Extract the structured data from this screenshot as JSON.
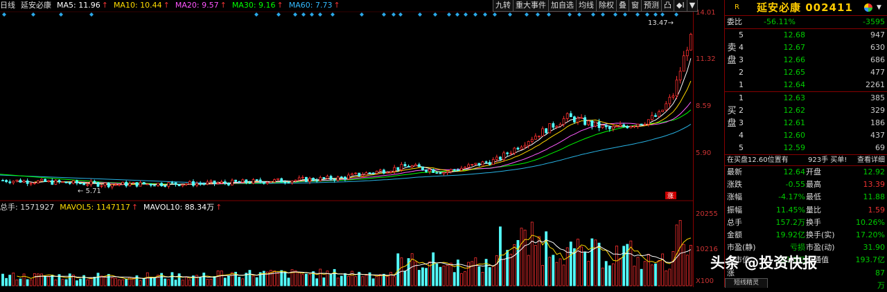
{
  "ma": {
    "period": "日线",
    "name": "延安必康",
    "ma5": "MA5: 11.96",
    "ma10": "MA10: 10.44",
    "ma20": "MA20: 9.57",
    "ma30": "MA30: 9.16",
    "ma60": "MA60: 7.73",
    "arrow": "↑"
  },
  "toolbar": [
    "九转",
    "重大事件",
    "加自选",
    "均线",
    "除权",
    "叠",
    "窗",
    "预测",
    "凸",
    "◆I",
    "▼"
  ],
  "chart_data": {
    "type": "candlestick",
    "price_ticks": [
      "14.01",
      "11.32",
      "8.59",
      "5.90"
    ],
    "price_range": [
      5.2,
      14.5
    ],
    "max_label": "13.47",
    "min_label": "5.71",
    "badge": "涨",
    "volume_ticks": [
      "20255",
      "10216",
      "X100"
    ],
    "volume_max": 21500,
    "colors": {
      "up": "#ff3030",
      "down": "#54ffff",
      "ma5": "#ffffff",
      "ma10": "#ffd700",
      "ma20": "#ff5cff",
      "ma30": "#00ff00",
      "ma60": "#28b4e6",
      "grid": "#800000"
    }
  },
  "volume": {
    "total": "总手: 1571927",
    "mavol5": "MAVOL5: 1147117",
    "mavol10": "MAVOL10: 88.34万",
    "arrow": "↑"
  },
  "quote": {
    "r": "R",
    "title": "延安必康 002411",
    "weibi_label": "委比",
    "weibi_pct": "-56.11%",
    "weibi_val": "-3595",
    "sell_side": "卖盘",
    "buy_side": "买盘",
    "asks": [
      {
        "n": "5",
        "p": "12.68",
        "v": "947"
      },
      {
        "n": "4",
        "p": "12.67",
        "v": "630"
      },
      {
        "n": "3",
        "p": "12.66",
        "v": "686"
      },
      {
        "n": "2",
        "p": "12.65",
        "v": "477"
      },
      {
        "n": "1",
        "p": "12.64",
        "v": "2261"
      }
    ],
    "bids": [
      {
        "n": "1",
        "p": "12.63",
        "v": "385"
      },
      {
        "n": "2",
        "p": "12.62",
        "v": "329"
      },
      {
        "n": "3",
        "p": "12.61",
        "v": "186"
      },
      {
        "n": "4",
        "p": "12.60",
        "v": "437"
      },
      {
        "n": "5",
        "p": "12.59",
        "v": "69"
      }
    ],
    "bid_note": "在买盘12.60位置有",
    "bid_note2": "923手  买单!",
    "detail": "查看详细",
    "stats": [
      {
        "l1": "最新",
        "v1": "12.64",
        "c1": "green",
        "l2": "开盘",
        "v2": "12.92",
        "c2": "green"
      },
      {
        "l1": "涨跌",
        "v1": "-0.55",
        "c1": "green",
        "l2": "最高",
        "v2": "13.39",
        "c2": "red"
      },
      {
        "l1": "涨幅",
        "v1": "-4.17%",
        "c1": "green",
        "l2": "最低",
        "v2": "11.88",
        "c2": "green"
      },
      {
        "l1": "振幅",
        "v1": "11.45%",
        "c1": "green",
        "l2": "量比",
        "v2": "1.59",
        "c2": "red"
      },
      {
        "l1": "总手",
        "v1": "157.2万",
        "c1": "green",
        "l2": "换手",
        "v2": "10.26%",
        "c2": "green"
      },
      {
        "l1": "金额",
        "v1": "19.92亿",
        "c1": "green",
        "l2": "换手(实)",
        "v2": "17.20%",
        "c2": "green"
      },
      {
        "l1": "市盈(静)",
        "v1": "亏损",
        "c1": "green",
        "l2": "市盈(动)",
        "v2": "31.90",
        "c2": "green"
      },
      {
        "l1": "总市值",
        "v1": "193.7亿",
        "c1": "green",
        "l2": "流通值",
        "v2": "193.7亿",
        "c2": "green"
      },
      {
        "l1": "涨",
        "v1": "",
        "c1": "green",
        "l2": "",
        "v2": "87",
        "c2": "green"
      },
      {
        "l1": "",
        "v1": "",
        "c1": "green",
        "l2": "",
        "v2": "万",
        "c2": "green"
      }
    ]
  },
  "watermark": "头条 @投资快报",
  "bottom_tab": "短线精灵"
}
